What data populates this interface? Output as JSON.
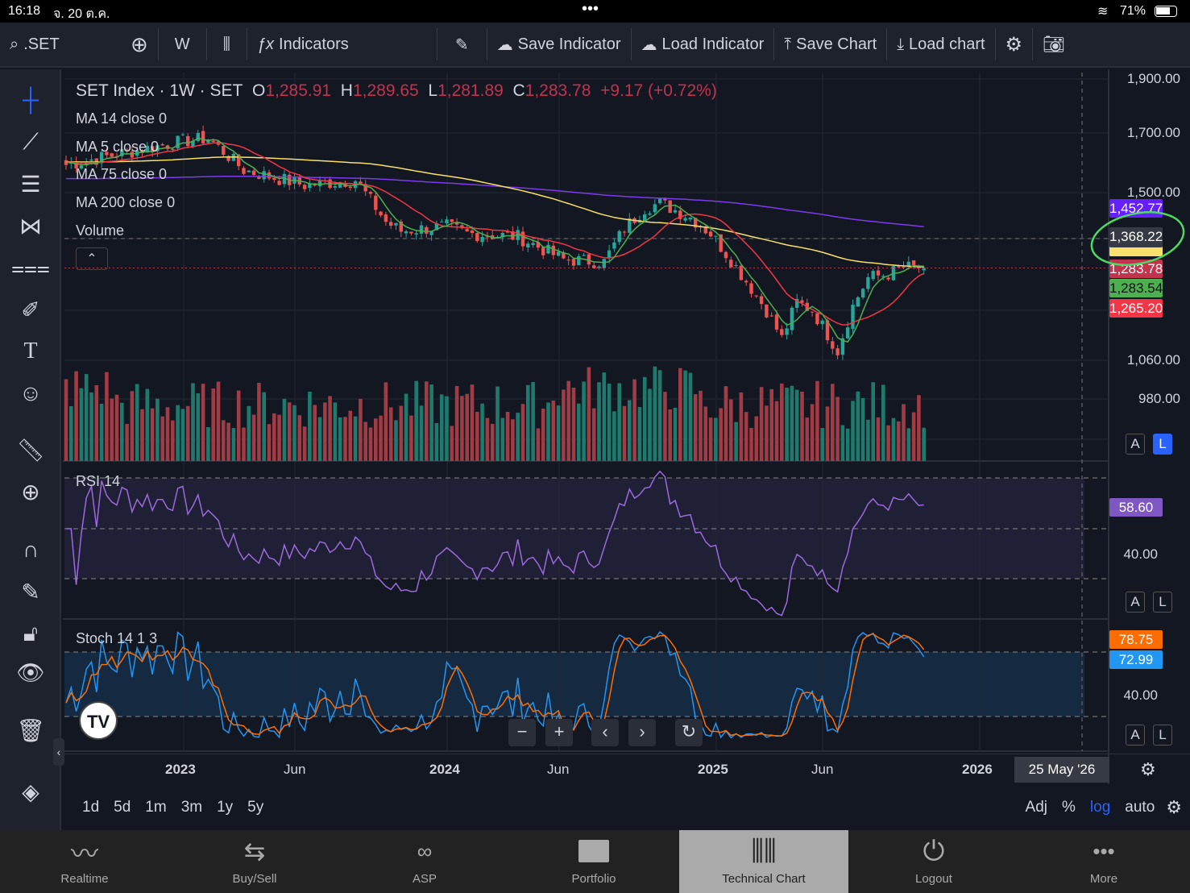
{
  "status": {
    "time": "16:18",
    "date": "จ. 20 ต.ค.",
    "battery": "71%"
  },
  "toolbar": {
    "symbol": ".SET",
    "interval": "W",
    "indicators": "Indicators",
    "save_indicator": "Save Indicator",
    "load_indicator": "Load Indicator",
    "save_chart": "Save Chart",
    "load_chart": "Load chart"
  },
  "legend": {
    "title": "SET Index · 1W · SET",
    "o_label": "O",
    "o": "1,285.91",
    "h_label": "H",
    "h": "1,289.65",
    "l_label": "L",
    "l": "1,281.89",
    "c_label": "C",
    "c": "1,283.78",
    "change": "+9.17 (+0.72%)",
    "ma14": "MA 14 close 0",
    "ma5": "MA 5 close 0",
    "ma75": "MA 75 close 0",
    "ma200": "MA 200 close 0",
    "volume": "Volume",
    "rsi": "RSI 14",
    "stoch": "Stoch 14 1 3"
  },
  "price_scale": [
    "1,900.00",
    "1,700.00",
    "1,500.00",
    "1,060.00",
    "980.00"
  ],
  "price_labels": {
    "ma200": "1,452.77",
    "crosshair": "1,368.22",
    "close": "1,283.78",
    "ma5": "1,283.54",
    "ma14": "1,265.20"
  },
  "rsi_scale": {
    "value": "58.60",
    "tick": "40.00"
  },
  "stoch_scale": {
    "k": "78.75",
    "d": "72.99",
    "tick": "40.00"
  },
  "scale_buttons": {
    "a": "A",
    "l": "L"
  },
  "time_axis": {
    "labels": [
      "2023",
      "Jun",
      "2024",
      "Jun",
      "2025",
      "Jun",
      "2026"
    ],
    "crosshair": "25 May '26"
  },
  "periods": [
    "1d",
    "5d",
    "1m",
    "3m",
    "1y",
    "5y"
  ],
  "options": {
    "adj": "Adj",
    "pct": "%",
    "log": "log",
    "auto": "auto"
  },
  "tabs": [
    {
      "label": "Realtime"
    },
    {
      "label": "Buy/Sell"
    },
    {
      "label": "ASP"
    },
    {
      "label": "Portfolio"
    },
    {
      "label": "Technical Chart"
    },
    {
      "label": "Logout"
    },
    {
      "label": "More"
    }
  ],
  "colors": {
    "up": "#26a69a",
    "down": "#ef5350",
    "ma5": "#4caf50",
    "ma14": "#f23645",
    "ma75": "#f7e06b",
    "ma200": "#7c3aed",
    "rsi": "#9c6ade",
    "stochK": "#2196f3",
    "stochD": "#ff6d00"
  },
  "chart_data": {
    "type": "candlestick",
    "timeframe": "1W",
    "close_keypoints": [
      [
        0,
        1590
      ],
      [
        23,
        1670
      ],
      [
        28,
        1680
      ],
      [
        35,
        1573
      ],
      [
        47,
        1524
      ],
      [
        57,
        1541
      ],
      [
        63,
        1413
      ],
      [
        66,
        1386
      ],
      [
        75,
        1400
      ],
      [
        79,
        1379
      ],
      [
        89,
        1370
      ],
      [
        98,
        1306
      ],
      [
        106,
        1300
      ],
      [
        110,
        1394
      ],
      [
        114,
        1453
      ],
      [
        117,
        1469
      ],
      [
        123,
        1426
      ],
      [
        127,
        1379
      ],
      [
        133,
        1268
      ],
      [
        138,
        1176
      ],
      [
        141,
        1109
      ],
      [
        144,
        1196
      ],
      [
        147,
        1176
      ],
      [
        152,
        1081
      ],
      [
        155,
        1186
      ],
      [
        158,
        1258
      ],
      [
        162,
        1268
      ],
      [
        165,
        1285
      ],
      [
        169,
        1283.78
      ]
    ],
    "ylim": [
      980,
      1900
    ],
    "scale": "log"
  }
}
